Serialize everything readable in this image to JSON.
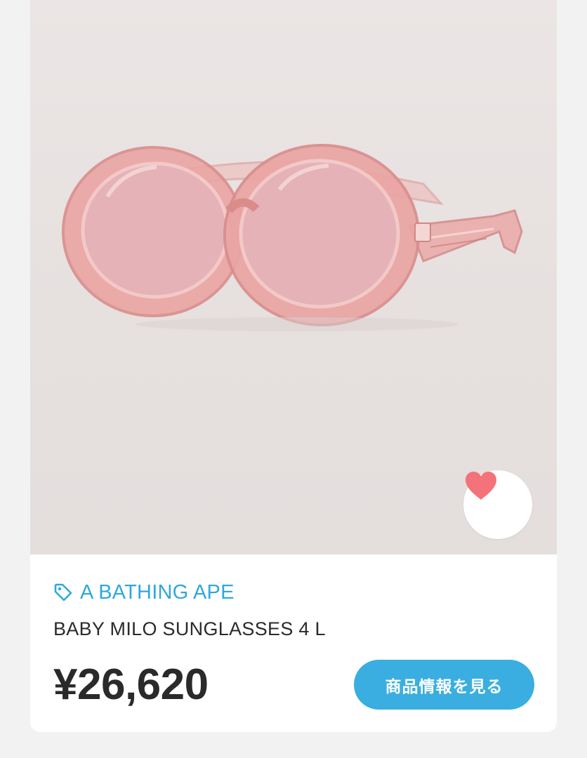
{
  "product": {
    "image_alt": "pink transparent oval sunglasses",
    "brand": "A BATHING APE",
    "name": "BABY MILO SUNGLASSES 4 L",
    "price": "¥26,620",
    "detail_button_label": "商品情報を見る"
  },
  "icons": {
    "brand": "tag-icon",
    "favorite": "heart-icon"
  },
  "colors": {
    "accent": "#3aaee0",
    "brand_text": "#2fa8dc",
    "favorite_heart": "#f4727a",
    "frame_pink": "#e8a3a2",
    "lens_pink": "#e4b1b6",
    "page_background": "#f2f2f2",
    "card_background": "#ffffff"
  }
}
